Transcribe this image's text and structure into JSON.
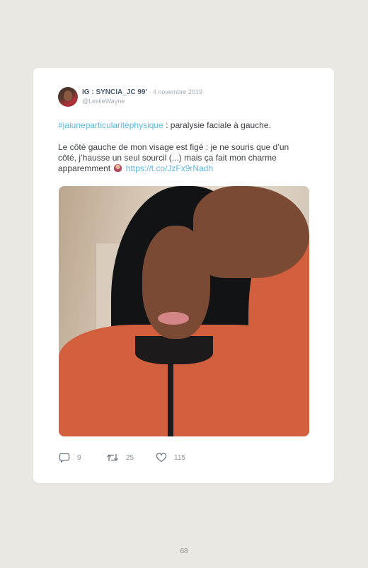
{
  "tweet": {
    "user_name": "IG : SYNCIA_JC 99'",
    "separator": " · ",
    "date": "4 novembre 2019",
    "handle": "@LeslieWayne",
    "hashtag": "#jaiuneparticularitéphysique",
    "line1_rest": " : paralysie faciale à gauche.",
    "paragraph2": "Le côté gauche de mon visage est figé : je ne souris que d’un côté, j’hausse un seul sourcil (...) mais ça fait mon charme apparemment",
    "emoji_name": "person-gesturing-no-emoji",
    "link": "https://t.co/JzFx9rNadh",
    "photo_description": "selfie-photo"
  },
  "actions": {
    "replies": "9",
    "retweets": "25",
    "likes": "115"
  },
  "colors": {
    "page_background": "#ebe8e4",
    "card_background": "#ffffff",
    "link": "#5bb8e6",
    "name": "#4a5b6c",
    "muted": "#a4adb6"
  },
  "page": {
    "number": "68"
  }
}
